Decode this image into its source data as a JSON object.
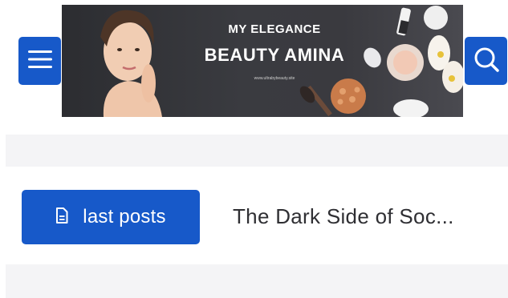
{
  "colors": {
    "accent": "#1759c9",
    "band": "#f4f4f6",
    "headline_text": "#2f2f33"
  },
  "header": {
    "menu_icon": "hamburger-menu-icon",
    "search_icon": "search-icon",
    "banner": {
      "subtitle": "MY ELEGANCE",
      "title": "BEAUTY AMINA",
      "url": "www.ultrabybeauty.site"
    }
  },
  "ticker": {
    "button_icon": "document-icon",
    "button_label": "last posts",
    "headline": "The Dark Side of Soc..."
  }
}
